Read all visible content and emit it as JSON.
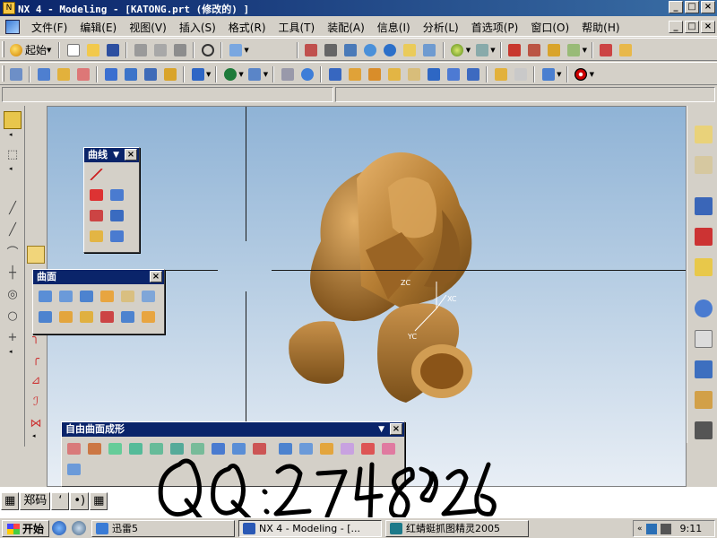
{
  "window": {
    "title": "NX 4 - Modeling - [KATONG.prt (修改的) ]",
    "app_icon": "nx-icon",
    "controls": [
      "_",
      "□",
      "×"
    ]
  },
  "menubar": {
    "items": [
      "文件(F)",
      "编辑(E)",
      "视图(V)",
      "插入(S)",
      "格式(R)",
      "工具(T)",
      "装配(A)",
      "信息(I)",
      "分析(L)",
      "首选项(P)",
      "窗口(O)",
      "帮助(H)"
    ],
    "controls": [
      "_",
      "□",
      "×"
    ]
  },
  "toolbar_standard": {
    "start_label": "起始",
    "icons": [
      "new-icon",
      "open-icon",
      "save-icon",
      "cut-icon",
      "copy-icon",
      "paste-icon",
      "undo-icon",
      "select-icon"
    ]
  },
  "toolbar_form_features": {
    "icons": [
      "sketch-icon",
      "extrude-icon",
      "revolve-icon",
      "block-icon",
      "cylinder-icon",
      "cone-icon",
      "sphere-icon",
      "boolean-icon"
    ]
  },
  "panels": {
    "curve": {
      "title": "曲线"
    },
    "surface": {
      "title": "曲面"
    },
    "freeform": {
      "title": "自由曲面成形"
    }
  },
  "viewport": {
    "csys_labels": {
      "xc": "XC",
      "yc": "YC",
      "zc": "ZC"
    },
    "colors": {
      "model": "#c08a3e",
      "bg_top": "#8fb3d6",
      "bg_bottom": "#e8eef5"
    }
  },
  "ime": {
    "input_method": "郑码",
    "items": [
      "ʻ",
      "•)",
      "▦"
    ]
  },
  "handwriting": {
    "text": "QQ:274898256"
  },
  "taskbar": {
    "start_label": "开始",
    "tasks": [
      {
        "label": "迅雷5",
        "icon": "xunlei-icon"
      },
      {
        "label": "NX 4 - Modeling - [...",
        "icon": "nx-icon"
      },
      {
        "label": "红蜻蜓抓图精灵2005",
        "icon": "camera-icon"
      }
    ],
    "clock": "9:11"
  }
}
